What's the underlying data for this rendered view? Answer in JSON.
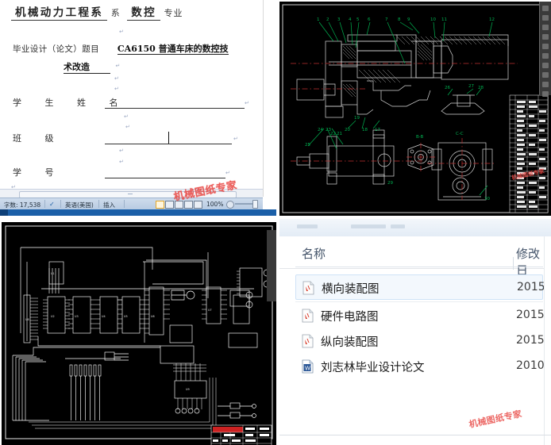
{
  "document": {
    "header": {
      "department": "机械动力工程系",
      "department_suffix": "系",
      "major": "数控",
      "major_suffix": "专业"
    },
    "thesis": {
      "label": "毕业设计（论文）题目",
      "title_line1": "CA6150  普通车床的数控技",
      "title_line2": "术改造"
    },
    "fields": [
      {
        "label": "学  生  姓  名",
        "value": ""
      },
      {
        "label": "班            级",
        "value": ""
      },
      {
        "label": "学            号",
        "value": ""
      }
    ],
    "statusbar": {
      "word_count": "字数: 17,538",
      "proofing_icon": "spellcheck-icon",
      "language": "英语(美国)",
      "insert_mode": "插入",
      "zoom_level": "100%",
      "zoom_out_icon": "zoom-out-icon"
    },
    "watermark": "机械图纸专家"
  },
  "cad_assembly": {
    "background": "#000000",
    "line_color": "#d8d8d8",
    "leader_color": "#00b050",
    "center_color": "#c03030",
    "view_labels": [
      "B-B",
      "C-C"
    ],
    "leader_numbers_top": [
      "1",
      "2",
      "3",
      "4",
      "5",
      "6",
      "7",
      "8",
      "9",
      "10",
      "11",
      "12"
    ],
    "leader_numbers_bottom": [
      "25",
      "24",
      "23",
      "22",
      "21",
      "20",
      "19",
      "18",
      "17",
      "16",
      "15",
      "14",
      "13"
    ],
    "detail_numbers": [
      "26",
      "27",
      "28"
    ],
    "panel_label": "cad-assembly-drawing"
  },
  "circuit": {
    "background": "#000000",
    "line_color": "#ffffff",
    "title_block_accent": "#cc2222",
    "chips": [
      "U1",
      "U2",
      "U3",
      "U4",
      "U5",
      "U6",
      "U7",
      "U8",
      "U9"
    ],
    "panel_label": "hardware-circuit-schematic"
  },
  "explorer": {
    "columns": {
      "name": "名称",
      "date_modified": "修改日"
    },
    "files": [
      {
        "name": "横向装配图",
        "date": "2015",
        "icon": "dwg-file-icon",
        "selected": true
      },
      {
        "name": "硬件电路图",
        "date": "2015",
        "icon": "dwg-file-icon",
        "selected": false
      },
      {
        "name": "纵向装配图",
        "date": "2015",
        "icon": "dwg-file-icon",
        "selected": false
      },
      {
        "name": "刘志林毕业设计论文",
        "date": "2010",
        "icon": "word-file-icon",
        "selected": false
      }
    ],
    "watermark": "机械图纸专家"
  }
}
